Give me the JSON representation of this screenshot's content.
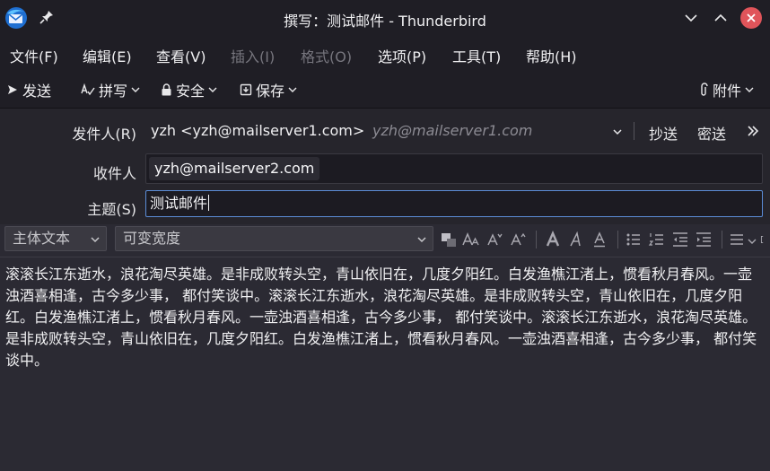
{
  "window": {
    "title": "撰写：测试邮件 - Thunderbird"
  },
  "menu": [
    "文件(F)",
    "编辑(E)",
    "查看(V)",
    "插入(I)",
    "格式(O)",
    "选项(P)",
    "工具(T)",
    "帮助(H)"
  ],
  "toolbar": {
    "send": "发送",
    "spell": "拼写",
    "security": "安全",
    "save": "保存",
    "attach": "附件"
  },
  "header": {
    "from_label": "发件人(R)",
    "from_name": "yzh <yzh@mailserver1.com>",
    "from_identity": "yzh@mailserver1.com",
    "cc": "抄送",
    "bcc": "密送",
    "to_label": "收件人",
    "to_pill": "yzh@mailserver2.com",
    "subject_label": "主题(S)",
    "subject_value": "测试邮件"
  },
  "format": {
    "paragraph": "主体文本",
    "font": "可变宽度"
  },
  "message_body": "滚滚长江东逝水，浪花淘尽英雄。是非成败转头空，青山依旧在，几度夕阳红。白发渔樵江渚上，惯看秋月春风。一壶浊酒喜相逢，古今多少事， 都付笑谈中。滚滚长江东逝水，浪花淘尽英雄。是非成败转头空，青山依旧在，几度夕阳红。白发渔樵江渚上，惯看秋月春风。一壶浊酒喜相逢，古今多少事， 都付笑谈中。滚滚长江东逝水，浪花淘尽英雄。是非成败转头空，青山依旧在，几度夕阳红。白发渔樵江渚上，惯看秋月春风。一壶浊酒喜相逢，古今多少事， 都付笑谈中。"
}
